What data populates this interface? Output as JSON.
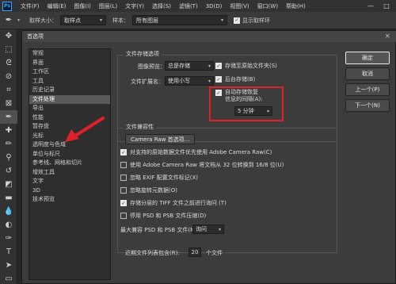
{
  "app": {
    "logo": "Ps"
  },
  "menu": [
    "文件(F)",
    "编辑(E)",
    "图像(I)",
    "图层(L)",
    "文字(Y)",
    "选择(S)",
    "滤镜(T)",
    "3D(D)",
    "视图(V)",
    "窗口(W)",
    "帮助(H)"
  ],
  "window_controls": {
    "minimize": "—",
    "maximize": "□"
  },
  "options_bar": {
    "tool_icon": "✒",
    "sample_size_label": "取样大小：",
    "sample_size_value": "取样点",
    "sample_label": "样本：",
    "sample_value": "所有图层",
    "show_ring_label": "显示取样环"
  },
  "dialog": {
    "title": "首选项",
    "close_glyph": "×",
    "categories": [
      "常规",
      "界面",
      "工作区",
      "工具",
      "历史记录",
      "文件处理",
      "导出",
      "性能",
      "暂存盘",
      "光标",
      "透明度与色域",
      "单位与标尺",
      "参考线、网格和切片",
      "增效工具",
      "文字",
      "3D",
      "技术预览"
    ],
    "selected_category": 5,
    "file_saving": {
      "group_label": "文件存储选项",
      "image_preview_label": "图像预览：",
      "image_preview_value": "总是存储",
      "file_ext_label": "文件扩展名：",
      "file_ext_value": "使用小写",
      "save_to_original_folder": "存储至原始文件夹(S)",
      "background_save": "后台存储(B)",
      "auto_save_line1": "自动存储恢复",
      "auto_save_line2": "信息的间隔(A):",
      "auto_save_interval": "5 分钟"
    },
    "compat": {
      "group_label": "文件兼容性",
      "camera_raw_button": "Camera Raw 首选项...",
      "options": [
        {
          "label": "对支持的原始数据文件优先使用 Adobe Camera Raw(C)",
          "checked": true
        },
        {
          "label": "使用 Adobe Camera Raw 将文档从 32 位转换到 16/8 位(U)",
          "checked": false
        },
        {
          "label": "忽略 EXIF 配置文件标记(X)",
          "checked": false
        },
        {
          "label": "忽略旋转元数据(O)",
          "checked": false
        },
        {
          "label": "存储分层的 TIFF 文件之前进行询问 (T)",
          "checked": true
        },
        {
          "label": "停用 PSD 和 PSB 文件压缩(D)",
          "checked": false
        }
      ],
      "max_compat_label": "最大兼容 PSD 和 PSB 文件(M):",
      "max_compat_value": "询问"
    },
    "recent": {
      "label": "近期文件列表包含(R):",
      "value": "20",
      "unit": "个文件"
    },
    "buttons": {
      "ok": "确定",
      "cancel": "取消",
      "prev": "上一个(P)",
      "next": "下一个(N)"
    }
  },
  "colors": {
    "annotation_red": "#e0202a"
  }
}
